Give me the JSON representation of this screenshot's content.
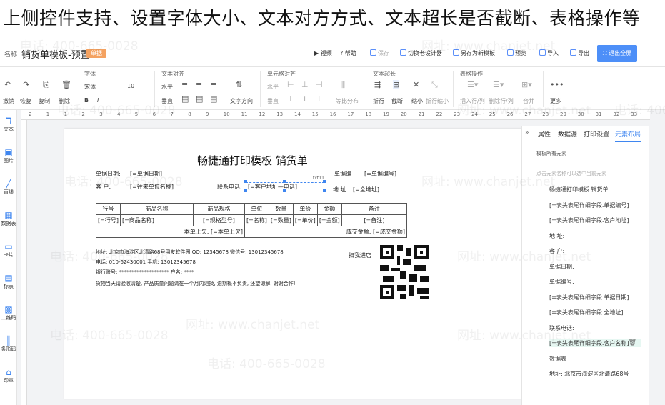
{
  "banner": {
    "text": "上侧控件支持、设置字体大小、文本对方方式、文本超长是否截断、表格操作等"
  },
  "topbar": {
    "name_label": "名称",
    "template_name": "销货单模板-预置",
    "badge": "单据",
    "actions": [
      {
        "label": "视频",
        "icon": "play-icon"
      },
      {
        "label": "帮助",
        "icon": "help-icon"
      },
      {
        "label": "保存",
        "icon": "save-icon"
      },
      {
        "label": "切换老设计器",
        "icon": "switch-icon"
      },
      {
        "label": "另存为新模板",
        "icon": "save-as-icon"
      },
      {
        "label": "预览",
        "icon": "preview-icon"
      },
      {
        "label": "导入",
        "icon": "import-icon"
      },
      {
        "label": "导出",
        "icon": "export-icon"
      }
    ],
    "exit_button": "退出全屏"
  },
  "toolbar": {
    "undo": "撤销",
    "redo": "恢复",
    "copy": "复制",
    "delete": "删除",
    "font_group": "字体",
    "font_name": "宋体",
    "font_size": "10",
    "text_align_group": "文本对齐",
    "horizontal": "水平",
    "vertical": "垂直",
    "text_direction": "文字方向",
    "cell_align_group": "单元格对齐",
    "cell_horizontal": "水平",
    "cell_vertical": "垂直",
    "distribute": "等比分布",
    "overflow_group": "文本超长",
    "wrap": "折行",
    "truncate": "截断",
    "shrink": "缩小",
    "wrap_shrink": "折行缩小",
    "table_group": "表格操作",
    "insert": "插入行/列",
    "delete_rowcol": "删除行/列",
    "merge": "合并",
    "more": "更多"
  },
  "ruler": {
    "ticks": [
      "2",
      "1",
      "1",
      "2",
      "3",
      "4",
      "5",
      "6",
      "7",
      "8",
      "9",
      "10",
      "11",
      "12",
      "13",
      "14",
      "15",
      "16",
      "17",
      "18",
      "19",
      "20",
      "21",
      "22",
      "23",
      "24",
      "25",
      "26",
      "27",
      "28",
      "29",
      "30",
      "31",
      "32",
      "33"
    ]
  },
  "leftbar": {
    "items": [
      {
        "label": "文本",
        "icon": "text-icon"
      },
      {
        "label": "图片",
        "icon": "image-icon"
      },
      {
        "label": "直线",
        "icon": "line-icon"
      },
      {
        "label": "数据表",
        "icon": "table-icon"
      },
      {
        "label": "卡片",
        "icon": "card-icon"
      },
      {
        "label": "标表",
        "icon": "grid-icon"
      },
      {
        "label": "二维码",
        "icon": "qrcode-icon"
      },
      {
        "label": "条形码",
        "icon": "barcode-icon"
      },
      {
        "label": "印章",
        "icon": "stamp-icon"
      }
    ]
  },
  "canvas": {
    "title": "畅捷通打印模板 销货单",
    "date_label": "单据日期:",
    "date_value": "[=单据日期]",
    "no_label": "单据编",
    "no_value": "[=单据编号]",
    "customer_label": "客 户:",
    "customer_value": "[=往来单位名称]",
    "phone_label": "联系电话:",
    "phone_value": "[=客户地址—电话]",
    "tag": "txt11",
    "addr_label": "地 址:",
    "addr_value": "[=全地址]",
    "table_headers": [
      "行号",
      "商品名称",
      "商品规格",
      "单位",
      "数量",
      "单价",
      "金额",
      "备注"
    ],
    "table_row": [
      "[=行号]",
      "[=商品名称]",
      "[=规格型号]",
      "[=名称]",
      "[=数量]",
      "[=单价]",
      "[=金额]",
      "[=备注]"
    ],
    "upper_label": "本单上欠:",
    "upper_value": "[=本单上欠]",
    "deal_label": "成交金额:",
    "deal_value": "[=成交金额]",
    "company_addr": "地址: 北京市海淀区北清路68号用友软件园 QQ: 12345678 微信号: 13012345678",
    "company_tel": "电话: 010-62430001 手机: 13012345678",
    "bank": "银行账号: ******************** 户名: ****",
    "notice": "货物当天请验收清楚, 产品质量问题请在一个月内退换, 逾期概不负责, 还望谅解, 谢谢合作!",
    "scan": "扫我进店"
  },
  "rpanel": {
    "tabs": [
      "属性",
      "数据源",
      "打印设置",
      "元素布局"
    ],
    "subtitle": "模板所有元素",
    "hint": "点击元素名称可以选中当前元素",
    "rows": [
      "畅捷通打印模板 销货单",
      "[=表头表尾详细字段.单据编号]",
      "[=表头表尾详细字段.客户地址]",
      "地 址:",
      "客 户:",
      "单据日期:",
      "单据编号:",
      "[=表头表尾详细字段.单据日期]",
      "[=表头表尾详细字段.全地址]",
      "联系电话:",
      "[=表头表尾详细字段.客户名称]",
      "数据表",
      "地址: 北京市海淀区北清路68号"
    ]
  },
  "watermarks": [
    "电话: 400-665-0028",
    "网址: www.chanjet.net"
  ]
}
